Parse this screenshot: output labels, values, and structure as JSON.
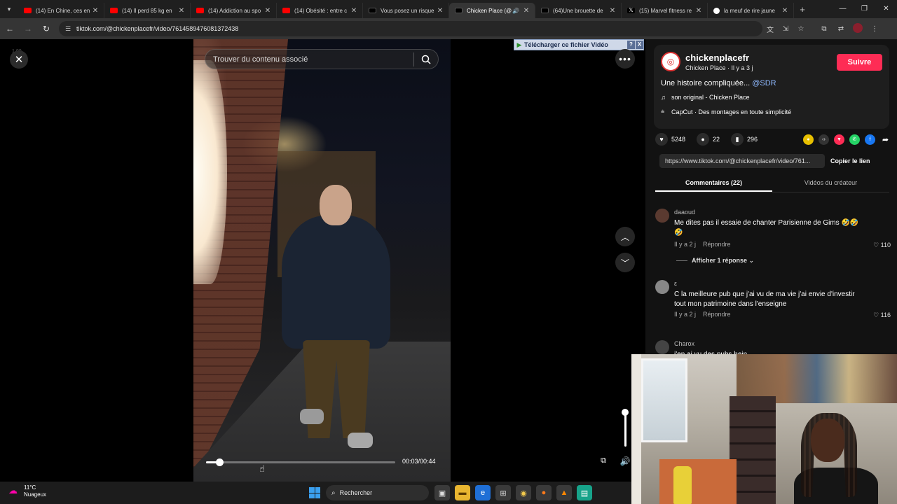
{
  "browser": {
    "tabs": [
      {
        "label": "(14) En Chine, ces en",
        "icon": "youtube-icon",
        "active": false
      },
      {
        "label": "(14) Il perd 85 kg en",
        "icon": "youtube-icon",
        "active": false
      },
      {
        "label": "(14) Addiction au spo",
        "icon": "youtube-icon",
        "active": false
      },
      {
        "label": "(14) Obésité : entre c",
        "icon": "youtube-icon",
        "active": false
      },
      {
        "label": "Vous posez un risque",
        "icon": "tiktok-icon",
        "active": false
      },
      {
        "label": "Chicken Place (@",
        "icon": "tiktok-icon",
        "active": true
      },
      {
        "label": "(64)Une brouette de",
        "icon": "tiktok-icon",
        "active": false
      },
      {
        "label": "(15) Marvel fitness re",
        "icon": "x-icon",
        "active": false
      },
      {
        "label": "la meuf de rire jaune",
        "icon": "google-icon",
        "active": false
      }
    ],
    "url": "tiktok.com/@chickenplacefr/video/7614589476081372438"
  },
  "player": {
    "search_placeholder": "Trouver du contenu associé",
    "time": "00:03/00:44",
    "progress": 0.07,
    "volume": 0.95,
    "corner_number": "1.00"
  },
  "extension": {
    "download_label": "Télécharger ce fichier Vidéo",
    "help": "?",
    "close": "X"
  },
  "creator": {
    "handle": "chickenplacefr",
    "subtitle": "Chicken Place · Il y a 3 j",
    "follow_label": "Suivre",
    "description": "Une histoire compliquée... ",
    "mention": "@SDR",
    "music": "son original - Chicken Place",
    "capcut": "CapCut · Des montages en toute simplicité"
  },
  "stats": {
    "likes": "5248",
    "comments": "22",
    "saves": "296"
  },
  "share": {
    "link": "https://www.tiktok.com/@chickenplacefr/video/761...",
    "copy_label": "Copier le lien"
  },
  "panel_tabs": {
    "comments": "Commentaires (22)",
    "creator_videos": "Vidéos du créateur"
  },
  "comments": [
    {
      "user": "daaoud",
      "text": "Me dites pas il essaie de chanter Parisienne de Gims 🤣🤣🤣",
      "time": "Il y a 2 j",
      "reply": "Répondre",
      "likes": "110",
      "replies": "Afficher 1 réponse"
    },
    {
      "user": "ε",
      "text": "C la meilleure pub que j'ai vu de ma vie j'ai envie d'investir tout mon patrimoine dans l'enseigne",
      "time": "Il y a 2 j",
      "reply": "Répondre",
      "likes": "116"
    },
    {
      "user": "Charox",
      "text": "j'en ai vu des pubs hein"
    }
  ],
  "taskbar": {
    "temperature": "11°C",
    "weather": "Nuageux",
    "search": "Rechercher"
  },
  "colors": {
    "accent": "#fe2c55",
    "mention": "#8fb9ff"
  }
}
